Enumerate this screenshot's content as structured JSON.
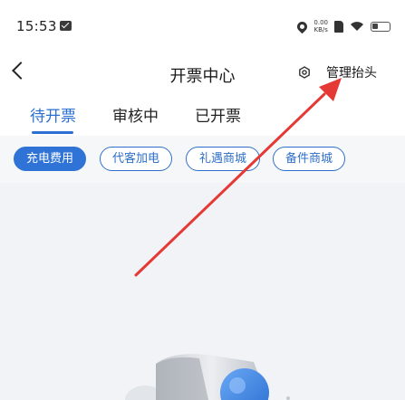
{
  "status_bar": {
    "time": "15:53",
    "net_speed_value": "0.00",
    "net_speed_unit": "KB/s"
  },
  "header": {
    "title": "开票中心",
    "manage_label": "管理抬头"
  },
  "tabs": [
    {
      "label": "待开票",
      "active": true
    },
    {
      "label": "审核中",
      "active": false
    },
    {
      "label": "已开票",
      "active": false
    }
  ],
  "filters": [
    {
      "label": "充电费用",
      "active": true
    },
    {
      "label": "代客加电",
      "active": false
    },
    {
      "label": "礼遇商城",
      "active": false
    },
    {
      "label": "备件商城",
      "active": false
    }
  ],
  "colors": {
    "accent": "#2a6fd1",
    "annotation_arrow": "#e53935"
  }
}
